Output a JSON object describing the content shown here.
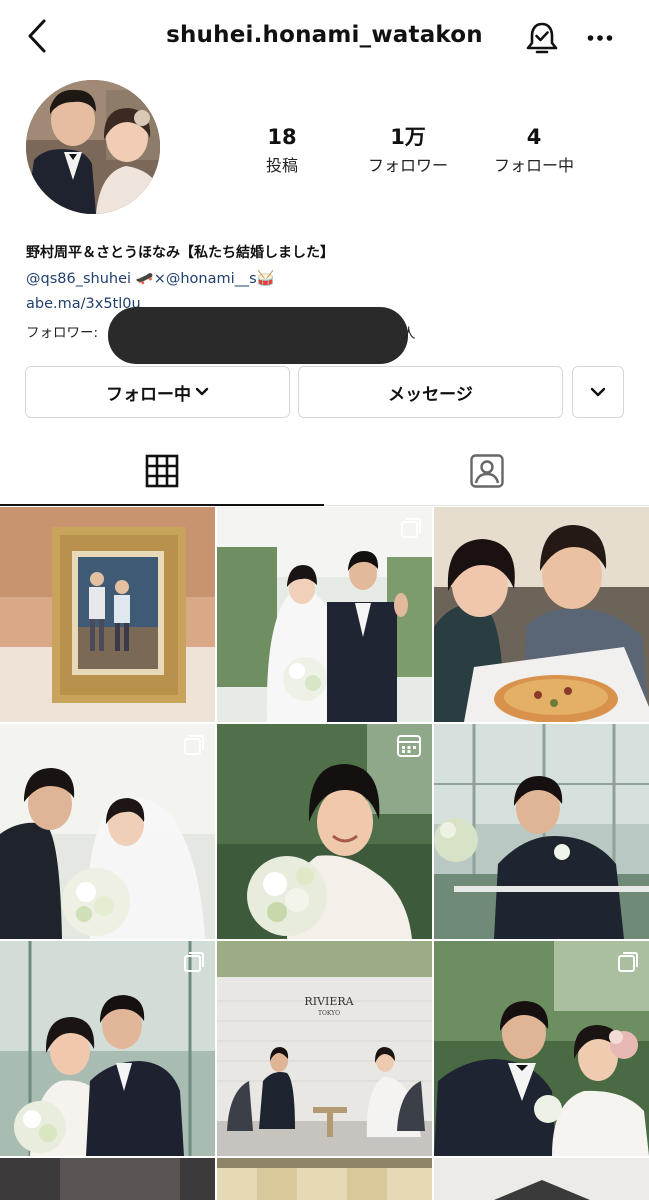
{
  "header": {
    "username": "shuhei.honami_watakon"
  },
  "profile": {
    "stats": [
      {
        "value": "18",
        "label": "投稿"
      },
      {
        "value": "1万",
        "label": "フォロワー"
      },
      {
        "value": "4",
        "label": "フォロー中"
      }
    ],
    "bio": {
      "name": "野村周平＆さとうほなみ【私たち結婚しました】",
      "line1": "@qs86_shuhei 🛹×@honami__s🥁",
      "link": "abe.ma/3x5tl0u",
      "followers_prefix": "フォロワー: ",
      "followers_tail": "人"
    }
  },
  "actions": {
    "follow_label": "フォロー中",
    "message_label": "メッセージ"
  },
  "tabs": [
    {
      "icon": "grid-icon",
      "active": true
    },
    {
      "icon": "tagged-person-icon",
      "active": false
    }
  ],
  "posts": [
    {
      "subject": "framed childhood photo",
      "badge": "none"
    },
    {
      "subject": "wedding couple waving",
      "badge": "carousel"
    },
    {
      "subject": "couple selfie with pizza",
      "badge": "none"
    },
    {
      "subject": "groom and veiled bride",
      "badge": "carousel"
    },
    {
      "subject": "bride with bouquet smiling",
      "badge": "reel"
    },
    {
      "subject": "groom leaning on railing",
      "badge": "none"
    },
    {
      "subject": "couple in greenhouse",
      "badge": "carousel"
    },
    {
      "subject": "couple toasting at RIVIERA TOKYO",
      "badge": "none"
    },
    {
      "subject": "couple in garden",
      "badge": "carousel"
    }
  ],
  "signage": {
    "venue": "RIVIERA",
    "venue_sub": "TOKYO"
  }
}
